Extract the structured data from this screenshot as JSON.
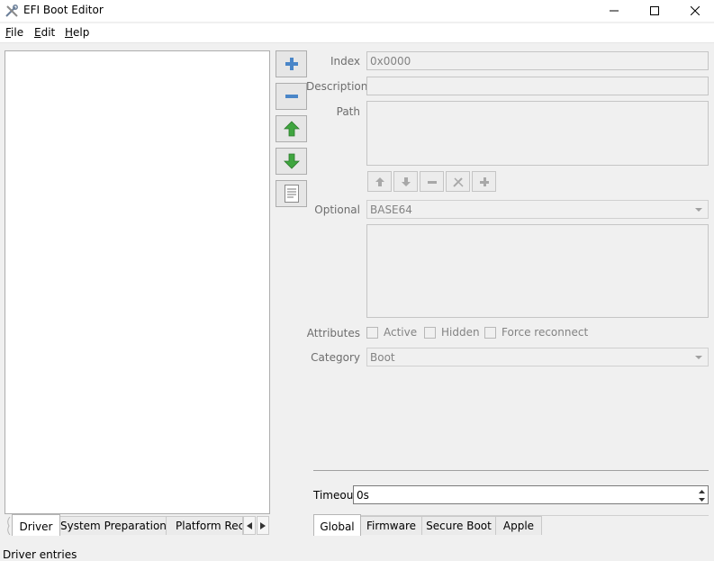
{
  "window": {
    "title": "EFI Boot Editor",
    "icon": "wrench-screwdriver-icon"
  },
  "menu": {
    "items": [
      "File",
      "Edit",
      "Help"
    ],
    "underline": [
      "F",
      "E",
      "H"
    ],
    "rest": [
      "ile",
      "dit",
      "elp"
    ]
  },
  "left_tabs": {
    "items": [
      "Driver",
      "System Preparation",
      "Platform Recov"
    ],
    "active": "Driver"
  },
  "side_buttons": [
    "add-icon",
    "remove-icon",
    "move-up-icon",
    "move-down-icon",
    "document-icon"
  ],
  "form": {
    "index_label": "Index",
    "index_value": "0x0000",
    "description_label": "Description",
    "description_value": "",
    "path_label": "Path",
    "path_buttons": [
      "up-arrow-icon",
      "down-arrow-icon",
      "minus-icon",
      "edit-icon",
      "plus-icon"
    ],
    "optional_label": "Optional",
    "optional_value": "BASE64",
    "attributes_label": "Attributes",
    "attributes": [
      "Active",
      "Hidden",
      "Force reconnect"
    ],
    "category_label": "Category",
    "category_value": "Boot"
  },
  "timeout": {
    "label": "Timeout",
    "value": "0s"
  },
  "right_tabs": {
    "items": [
      "Global",
      "Firmware",
      "Secure Boot",
      "Apple"
    ],
    "active": "Global"
  },
  "status": "Driver entries",
  "colors": {
    "green_arrow": "#3fa53f",
    "blue_icon": "#4a86c8"
  }
}
